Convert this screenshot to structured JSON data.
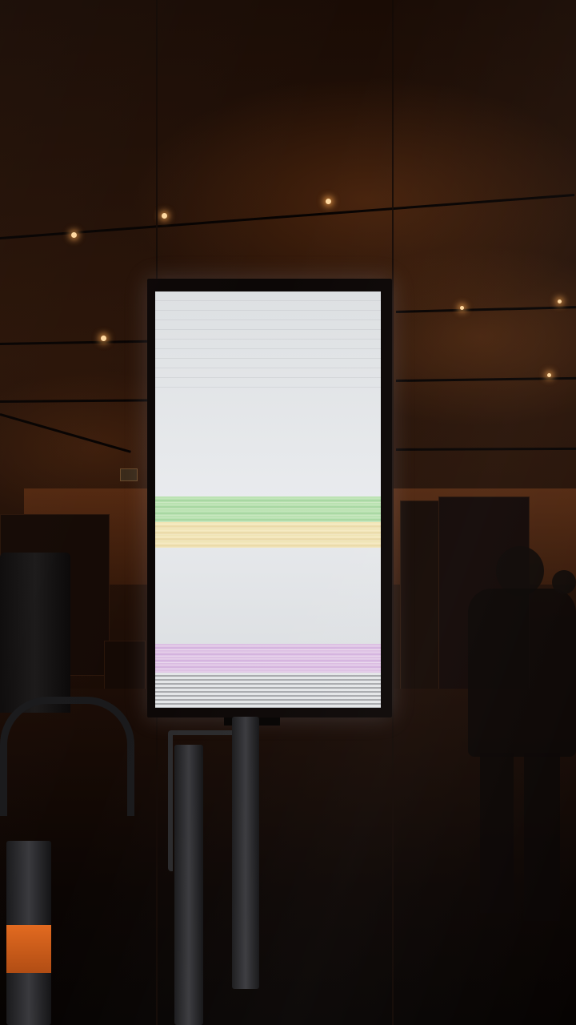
{
  "scene": {
    "description_name": "store-interior-photo",
    "colors": {
      "ambient": "#2a1408",
      "screen_white": "#e9ebee",
      "band_green": "#b6e0ad",
      "band_yellow": "#efe3b0",
      "band_purple": "#d8b8e0",
      "spotlight": "#ffd9a0"
    }
  }
}
